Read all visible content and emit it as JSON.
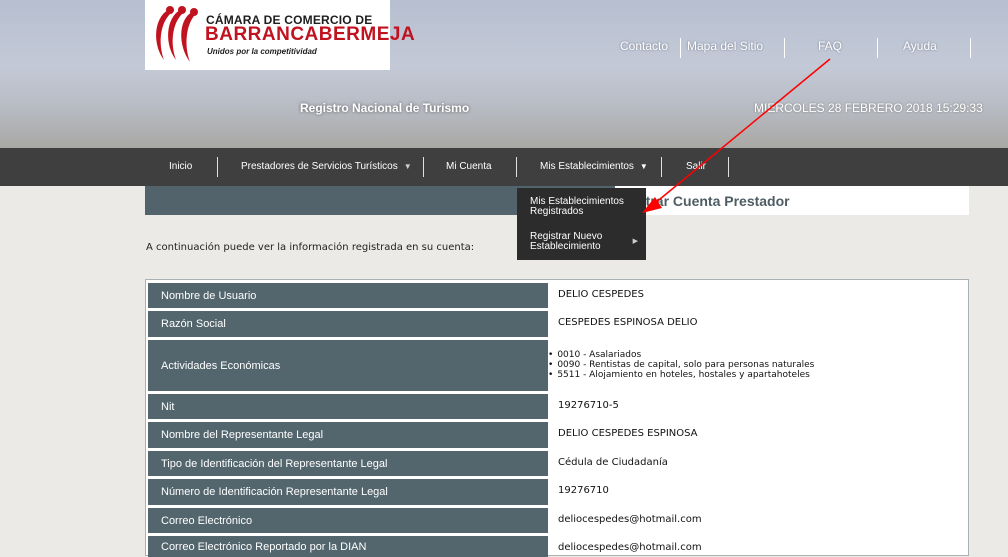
{
  "header": {
    "logo": {
      "line1": "CÁMARA DE COMERCIO DE",
      "line2": "BARRANCABERMEJA",
      "tagline": "Unidos por la competitividad"
    },
    "top_links": [
      "Contacto",
      "Mapa del Sitio",
      "FAQ",
      "Ayuda"
    ],
    "site_title": "Registro Nacional de Turismo",
    "date": "MIERCOLES 28 FEBRERO 2018 15:29:33"
  },
  "nav": {
    "items": [
      "Inicio",
      "Prestadores de Servicios Turísticos",
      "Mi Cuenta",
      "Mis Establecimientos",
      "Salir"
    ]
  },
  "dropdown": {
    "item1": {
      "line1": "Mis Establecimientos",
      "line2": "Registrados"
    },
    "item2": {
      "line1": "Registrar Nuevo",
      "line2": "Establecimiento"
    }
  },
  "section_title": "ninistrar Cuenta Prestador",
  "intro": "A continuación puede ver la información registrada en su cuenta:",
  "table": {
    "rows": [
      {
        "label": "Nombre de Usuario",
        "value": "DELIO CESPEDES"
      },
      {
        "label": "Razón Social",
        "value": "CESPEDES ESPINOSA DELIO"
      },
      {
        "label": "Actividades Económicas",
        "values": [
          "0010 - Asalariados",
          "0090 - Rentistas de capital, solo para personas naturales",
          "5511 - Alojamiento en hoteles, hostales y apartahoteles"
        ]
      },
      {
        "label": "Nit",
        "value": "19276710-5"
      },
      {
        "label": "Nombre del Representante Legal",
        "value": "DELIO CESPEDES ESPINOSA"
      },
      {
        "label": "Tipo de Identificación del Representante Legal",
        "value": "Cédula de Ciudadanía"
      },
      {
        "label": "Número de Identificación Representante Legal",
        "value": "19276710"
      },
      {
        "label": "Correo Electrónico",
        "value": "deliocespedes@hotmail.com"
      },
      {
        "label": "Correo Electrónico Reportado por la DIAN",
        "value": "deliocespedes@hotmail.com"
      }
    ]
  },
  "colors": {
    "label_bg": "#53656d",
    "nav_bg": "#3f3f3f",
    "annotation_arrow": "#ff0000",
    "brand_red": "#c1121f"
  }
}
